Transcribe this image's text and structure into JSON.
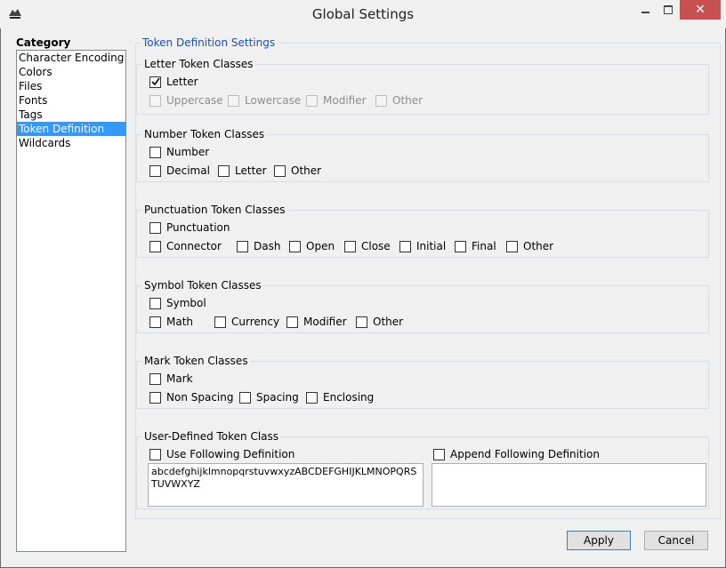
{
  "window": {
    "title": "Global Settings"
  },
  "category": {
    "label": "Category",
    "items": [
      {
        "label": "Character Encoding",
        "selected": false
      },
      {
        "label": "Colors",
        "selected": false
      },
      {
        "label": "Files",
        "selected": false
      },
      {
        "label": "Fonts",
        "selected": false
      },
      {
        "label": "Tags",
        "selected": false
      },
      {
        "label": "Token Definition",
        "selected": true
      },
      {
        "label": "Wildcards",
        "selected": false
      }
    ]
  },
  "settings_title": "Token Definition Settings",
  "letter": {
    "title": "Letter Token Classes",
    "letter": {
      "label": "Letter",
      "checked": true
    },
    "uppercase": {
      "label": "Uppercase",
      "checked": false
    },
    "lowercase": {
      "label": "Lowercase",
      "checked": false
    },
    "modifier": {
      "label": "Modifier",
      "checked": false
    },
    "other": {
      "label": "Other",
      "checked": false
    }
  },
  "number": {
    "title": "Number Token Classes",
    "number": {
      "label": "Number",
      "checked": false
    },
    "decimal": {
      "label": "Decimal",
      "checked": false
    },
    "letter": {
      "label": "Letter",
      "checked": false
    },
    "other": {
      "label": "Other",
      "checked": false
    }
  },
  "punctuation": {
    "title": "Punctuation Token Classes",
    "punctuation": {
      "label": "Punctuation",
      "checked": false
    },
    "connector": {
      "label": "Connector",
      "checked": false
    },
    "dash": {
      "label": "Dash",
      "checked": false
    },
    "open": {
      "label": "Open",
      "checked": false
    },
    "close": {
      "label": "Close",
      "checked": false
    },
    "initial": {
      "label": "Initial",
      "checked": false
    },
    "final": {
      "label": "Final",
      "checked": false
    },
    "other": {
      "label": "Other",
      "checked": false
    }
  },
  "symbol": {
    "title": "Symbol Token Classes",
    "symbol": {
      "label": "Symbol",
      "checked": false
    },
    "math": {
      "label": "Math",
      "checked": false
    },
    "currency": {
      "label": "Currency",
      "checked": false
    },
    "modifier": {
      "label": "Modifier",
      "checked": false
    },
    "other": {
      "label": "Other",
      "checked": false
    }
  },
  "mark": {
    "title": "Mark Token Classes",
    "mark": {
      "label": "Mark",
      "checked": false
    },
    "nonspacing": {
      "label": "Non Spacing",
      "checked": false
    },
    "spacing": {
      "label": "Spacing",
      "checked": false
    },
    "enclosing": {
      "label": "Enclosing",
      "checked": false
    }
  },
  "user": {
    "title": "User-Defined Token Class",
    "use": {
      "label": "Use Following Definition",
      "checked": false
    },
    "append": {
      "label": "Append Following Definition",
      "checked": false
    },
    "use_text": "abcdefghijklmnopqrstuvwxyzABCDEFGHIJKLMNOPQRSTUVWXYZ",
    "append_text": ""
  },
  "buttons": {
    "apply": "Apply",
    "cancel": "Cancel"
  },
  "colors": {
    "selection": "#3399ff",
    "close_button": "#c75050",
    "legend": "#1a50b8"
  }
}
